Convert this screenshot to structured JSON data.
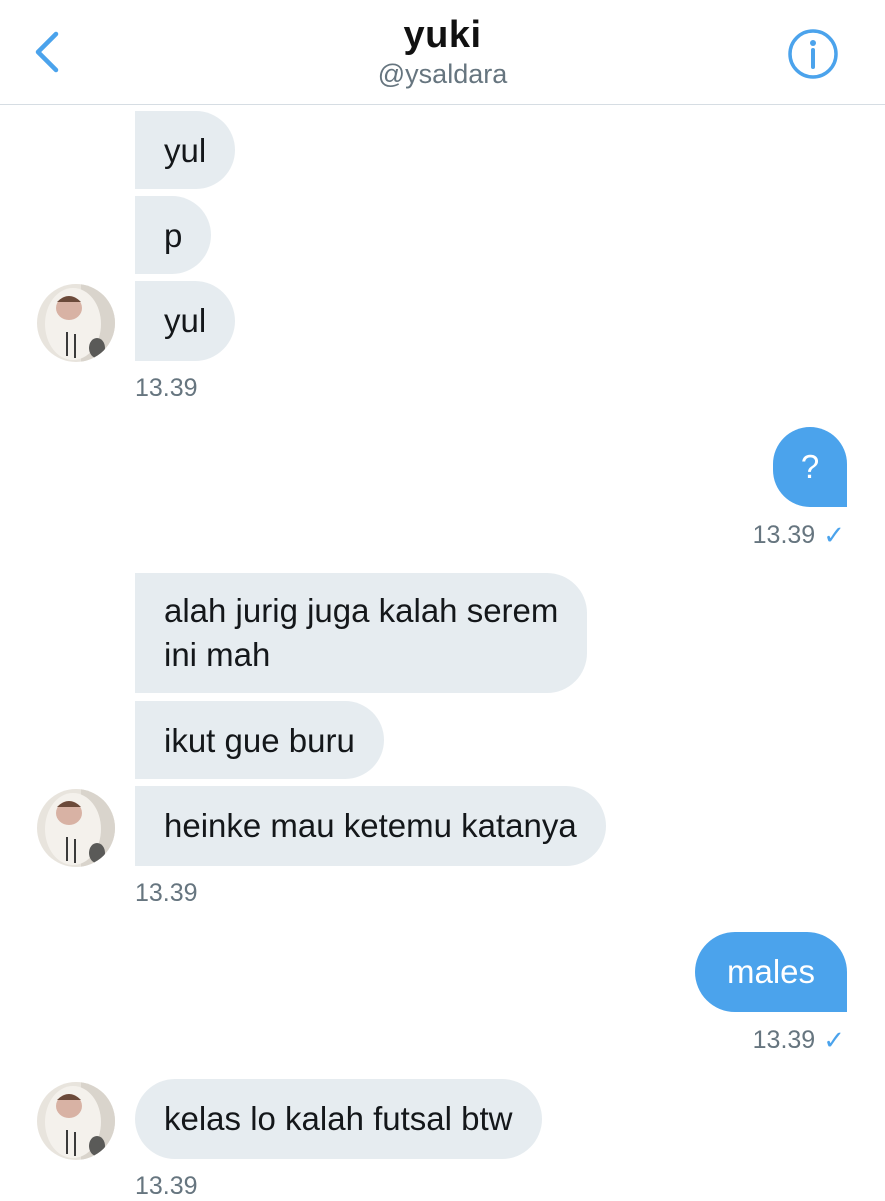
{
  "header": {
    "title": "yuki",
    "handle": "@ysaldara",
    "back_icon": "chevron-left-icon",
    "info_icon": "info-icon",
    "accent_color": "#4ba3ec"
  },
  "messages": [
    {
      "side": "in",
      "text": "yul"
    },
    {
      "side": "in",
      "text": "p"
    },
    {
      "side": "in",
      "text": "yul"
    },
    {
      "side": "in",
      "time": "13.39"
    },
    {
      "side": "out",
      "text": "?",
      "time": "13.39",
      "status": "✓"
    },
    {
      "side": "in",
      "line1": "alah jurig juga kalah serem",
      "line2": "ini mah"
    },
    {
      "side": "in",
      "text": "ikut gue buru"
    },
    {
      "side": "in",
      "text": "heinke mau ketemu katanya"
    },
    {
      "side": "in",
      "time": "13.39"
    },
    {
      "side": "out",
      "text": "males",
      "time": "13.39",
      "status": "✓"
    },
    {
      "side": "in",
      "text": "kelas lo kalah futsal btw",
      "time": "13.39"
    }
  ]
}
